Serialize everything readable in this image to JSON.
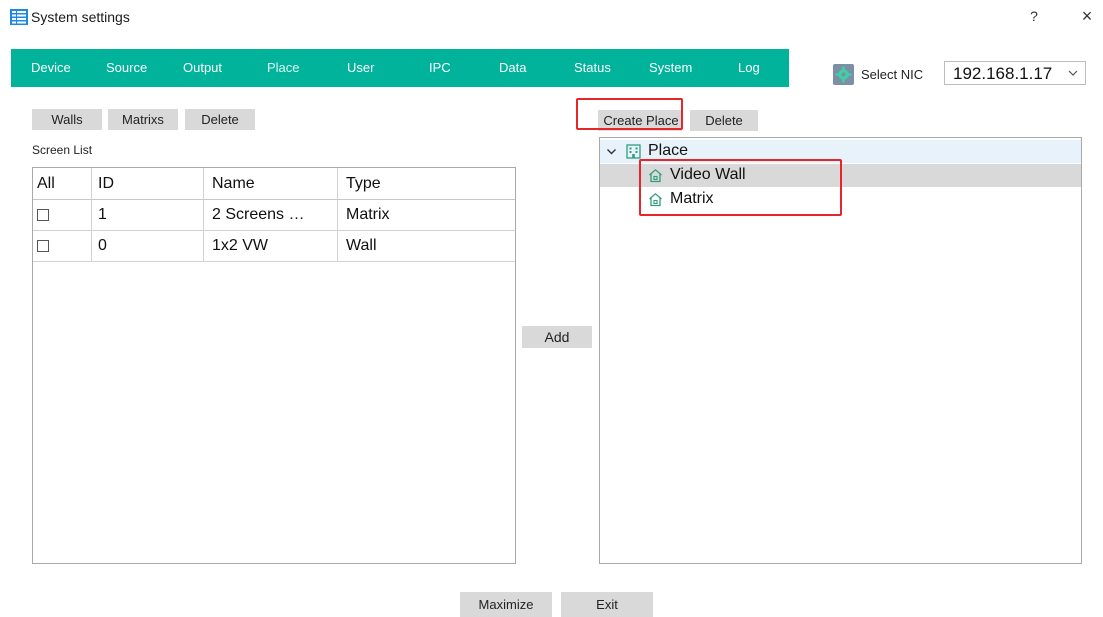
{
  "window": {
    "title": "System settings",
    "help_label": "?",
    "close_label": "×",
    "icon": "list-grid-icon"
  },
  "nav": {
    "items": [
      {
        "label": "Device"
      },
      {
        "label": "Source"
      },
      {
        "label": "Output"
      },
      {
        "label": "Place",
        "active": true
      },
      {
        "label": "User"
      },
      {
        "label": "IPC"
      },
      {
        "label": "Data"
      },
      {
        "label": "Status"
      },
      {
        "label": "System"
      },
      {
        "label": "Log"
      }
    ],
    "color": "#00b39a"
  },
  "nic": {
    "icon": "gear-icon",
    "label": "Select NIC",
    "value": "192.168.1.17"
  },
  "left": {
    "buttons": {
      "walls": "Walls",
      "matrixs": "Matrixs",
      "delete": "Delete"
    },
    "list_label": "Screen List",
    "table": {
      "columns": [
        "All",
        "ID",
        "Name",
        "Type"
      ],
      "rows": [
        {
          "checked": false,
          "id": "1",
          "name": "2 Screens …",
          "type": "Matrix"
        },
        {
          "checked": false,
          "id": "0",
          "name": "1x2 VW",
          "type": "Wall"
        }
      ]
    }
  },
  "middle": {
    "add_label": "Add"
  },
  "right": {
    "buttons": {
      "create_place": "Create Place",
      "delete": "Delete"
    },
    "tree": {
      "root": {
        "label": "Place",
        "icon": "building-icon",
        "expanded": true
      },
      "children": [
        {
          "label": "Video Wall",
          "icon": "home-icon",
          "selected": true
        },
        {
          "label": "Matrix",
          "icon": "home-icon",
          "selected": false
        }
      ]
    }
  },
  "footer": {
    "maximize_label": "Maximize",
    "exit_label": "Exit"
  },
  "highlight_color": "#e5262a"
}
